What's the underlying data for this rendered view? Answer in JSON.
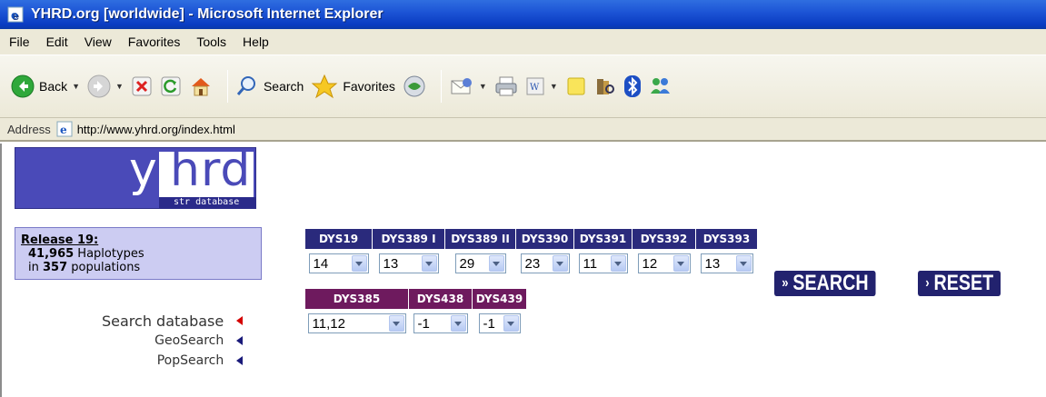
{
  "window": {
    "title": "YHRD.org [worldwide] - Microsoft Internet Explorer"
  },
  "menu": [
    "File",
    "Edit",
    "View",
    "Favorites",
    "Tools",
    "Help"
  ],
  "toolbar": {
    "back_label": "Back",
    "search_label": "Search",
    "favorites_label": "Favorites"
  },
  "address": {
    "label": "Address",
    "url": "http://www.yhrd.org/index.html"
  },
  "logo": {
    "y": "y",
    "hrd": "hrd",
    "sub": "str database"
  },
  "release": {
    "title": "Release 19:",
    "haplotypes_count": "41,965",
    "haplotypes_label": " Haplotypes",
    "populations_prefix": "in ",
    "populations_count": "357",
    "populations_label": " populations"
  },
  "side_nav": {
    "search_database": "Search database",
    "geosearch": "GeoSearch",
    "popsearch": "PopSearch"
  },
  "markers_row1": [
    {
      "name": "DYS19",
      "value": "14"
    },
    {
      "name": "DYS389 I",
      "value": "13"
    },
    {
      "name": "DYS389 II",
      "value": "29"
    },
    {
      "name": "DYS390",
      "value": "23"
    },
    {
      "name": "DYS391",
      "value": "11"
    },
    {
      "name": "DYS392",
      "value": "12"
    },
    {
      "name": "DYS393",
      "value": "13"
    }
  ],
  "markers_row2": [
    {
      "name": "DYS385",
      "value": "11,12"
    },
    {
      "name": "DYS438",
      "value": "-1"
    },
    {
      "name": "DYS439",
      "value": "-1"
    }
  ],
  "buttons": {
    "search": "SEARCH",
    "reset": "RESET"
  },
  "colors": {
    "marker_header_blue": "#2a2a7c",
    "marker_header_purple": "#6e1a5e",
    "release_box_bg": "#ccccf2",
    "side_arrow_red": "#d40000",
    "side_arrow_blue": "#1a1a7a"
  }
}
